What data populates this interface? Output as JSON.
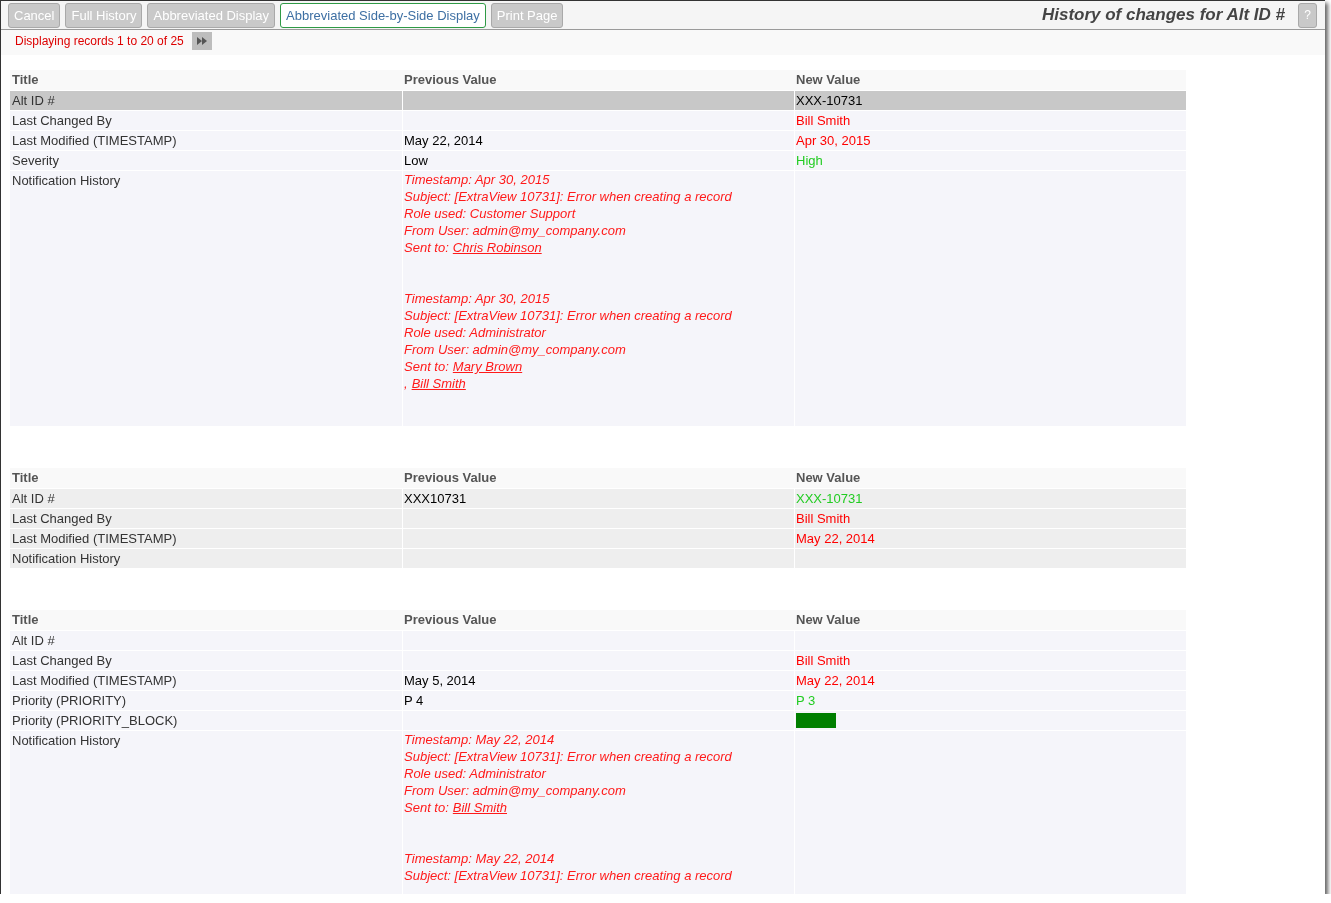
{
  "toolbar": {
    "buttons": [
      {
        "label": "Cancel",
        "selected": false
      },
      {
        "label": "Full History",
        "selected": false
      },
      {
        "label": "Abbreviated Display",
        "selected": false
      },
      {
        "label": "Abbreviated Side-by-Side Display",
        "selected": true
      },
      {
        "label": "Print Page",
        "selected": false
      }
    ],
    "title": "History of changes for Alt ID #",
    "help": "?"
  },
  "pager": {
    "text": "Displaying records 1 to 20 of 25"
  },
  "records": [
    {
      "shaded": false,
      "columns": [
        "Title",
        "Previous Value",
        "New Value"
      ],
      "rows": [
        {
          "title": "Alt ID #",
          "highlighted": true,
          "new": {
            "kind": "text",
            "text": "XXX-10731",
            "color": "#000000"
          }
        },
        {
          "title": "Last Changed By",
          "highlighted": false,
          "new": {
            "kind": "text",
            "text": "Bill Smith",
            "color": "#ff0000"
          }
        },
        {
          "title": "Last Modified (TIMESTAMP)",
          "highlighted": false,
          "previous": {
            "kind": "text",
            "text": "May 22, 2014"
          },
          "new": {
            "kind": "text",
            "text": "Apr 30, 2015",
            "color": "#ff0000"
          }
        },
        {
          "title": "Severity",
          "highlighted": false,
          "previous": {
            "kind": "text",
            "text": "Low"
          },
          "new": {
            "kind": "text",
            "text": "High",
            "color": "#22cc22"
          }
        },
        {
          "title": "Notification History",
          "highlighted": false,
          "previous": {
            "kind": "notifications",
            "entries": [
              {
                "lines": [
                  "Timestamp: Apr 30, 2015",
                  "Subject: [ExtraView 10731]: Error when creating a record",
                  "Role used: Customer Support",
                  "From User: admin@my_company.com"
                ],
                "recipients": [
                  {
                    "prefix": "Sent to:",
                    "name": "Chris Robinson"
                  }
                ]
              },
              {
                "lines": [
                  "Timestamp: Apr 30, 2015",
                  "Subject: [ExtraView 10731]: Error when creating a record",
                  "Role used: Administrator",
                  "From User: admin@my_company.com"
                ],
                "recipients": [
                  {
                    "prefix": "Sent to:",
                    "name": "Mary Brown"
                  },
                  {
                    "prefix": ",",
                    "name": "Bill Smith"
                  }
                ]
              }
            ]
          }
        }
      ]
    },
    {
      "shaded": true,
      "columns": [
        "Title",
        "Previous Value",
        "New Value"
      ],
      "rows": [
        {
          "title": "Alt ID #",
          "highlighted": false,
          "previous": {
            "kind": "text",
            "text": "XXX10731"
          },
          "new": {
            "kind": "text",
            "text": "XXX-10731",
            "color": "#22cc22"
          }
        },
        {
          "title": "Last Changed By",
          "highlighted": false,
          "new": {
            "kind": "text",
            "text": "Bill Smith",
            "color": "#ff0000"
          }
        },
        {
          "title": "Last Modified (TIMESTAMP)",
          "highlighted": false,
          "new": {
            "kind": "text",
            "text": "May 22, 2014",
            "color": "#ff0000"
          }
        },
        {
          "title": "Notification History",
          "highlighted": false
        }
      ]
    },
    {
      "shaded": false,
      "columns": [
        "Title",
        "Previous Value",
        "New Value"
      ],
      "rows": [
        {
          "title": "Alt ID #",
          "highlighted": false
        },
        {
          "title": "Last Changed By",
          "highlighted": false,
          "new": {
            "kind": "text",
            "text": "Bill Smith",
            "color": "#ff0000"
          }
        },
        {
          "title": "Last Modified (TIMESTAMP)",
          "highlighted": false,
          "previous": {
            "kind": "text",
            "text": "May 5, 2014"
          },
          "new": {
            "kind": "text",
            "text": "May 22, 2014",
            "color": "#ff0000"
          }
        },
        {
          "title": "Priority (PRIORITY)",
          "highlighted": false,
          "previous": {
            "kind": "text",
            "text": "P 4"
          },
          "new": {
            "kind": "text",
            "text": "P 3",
            "color": "#22cc22"
          }
        },
        {
          "title": "Priority (PRIORITY_BLOCK)",
          "highlighted": false,
          "new": {
            "kind": "swatch",
            "color": "#007f00"
          }
        },
        {
          "title": "Notification History",
          "highlighted": false,
          "previous": {
            "kind": "notifications",
            "entries": [
              {
                "lines": [
                  "Timestamp: May 22, 2014",
                  "Subject: [ExtraView 10731]: Error when creating a record",
                  "Role used: Administrator",
                  "From User: admin@my_company.com"
                ],
                "recipients": [
                  {
                    "prefix": "Sent to:",
                    "name": "Bill Smith"
                  }
                ]
              },
              {
                "lines": [
                  "Timestamp: May 22, 2014",
                  "Subject: [ExtraView 10731]: Error when creating a record"
                ]
              }
            ]
          }
        }
      ]
    }
  ]
}
